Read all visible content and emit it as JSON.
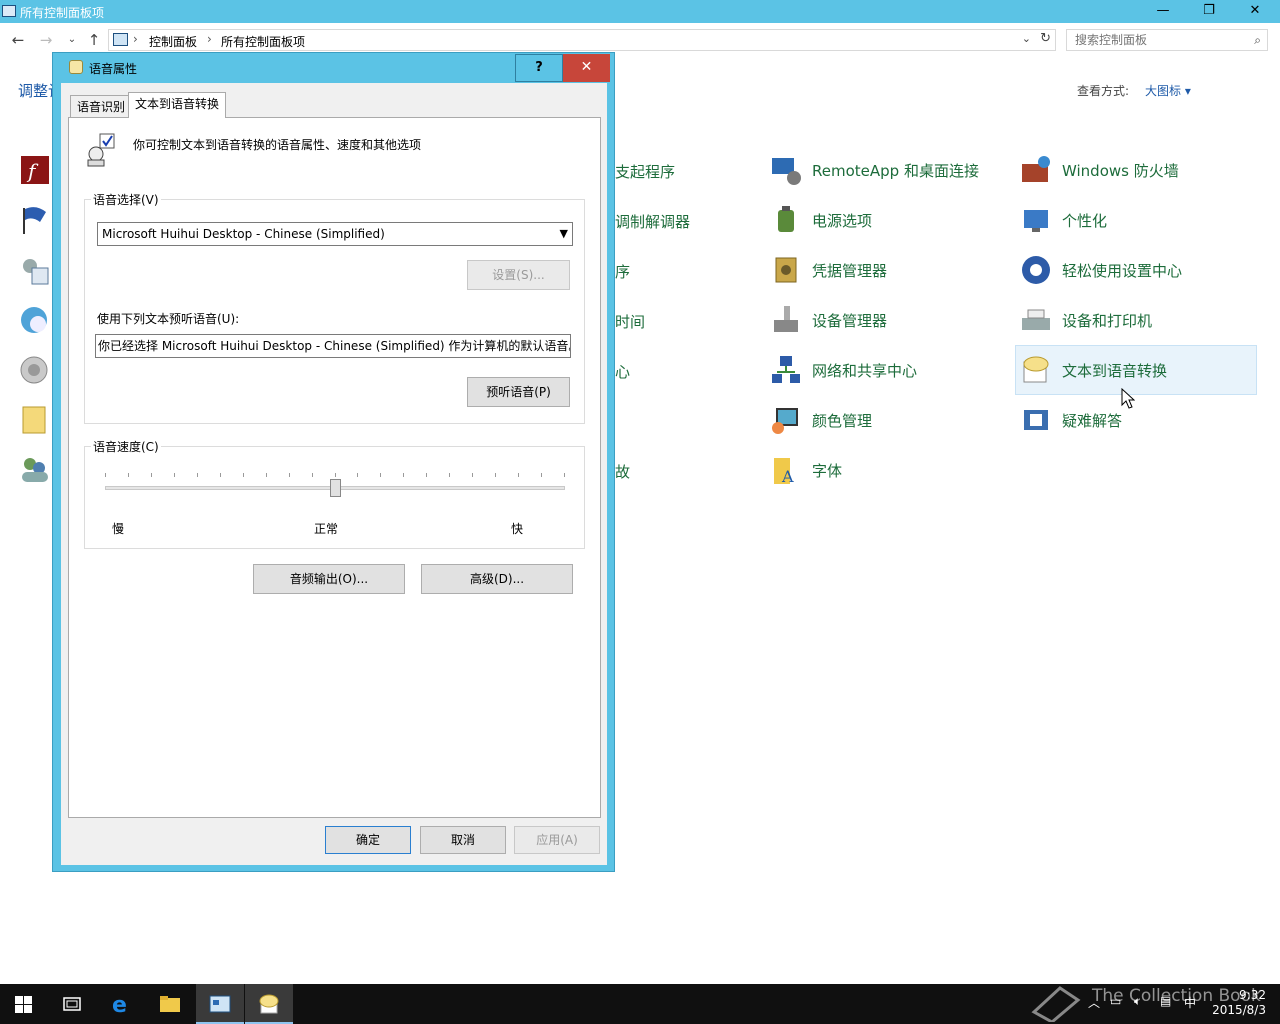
{
  "explorer": {
    "title": "所有控制面板项",
    "breadcrumb": [
      "控制面板",
      "所有控制面板项"
    ],
    "search_placeholder": "搜索控制面板",
    "left_heading": "调整计",
    "view_by_label": "查看方式:",
    "view_by_value": "大图标 ▾",
    "partial_items": [
      "支起程序",
      "调制解调器",
      "序",
      "时间",
      "心",
      "",
      "故"
    ],
    "items_col2": [
      "RemoteApp 和桌面连接",
      "电源选项",
      "凭据管理器",
      "设备管理器",
      "网络和共享中心",
      "颜色管理",
      "字体"
    ],
    "items_col3": [
      "Windows 防火墙",
      "个性化",
      "轻松使用设置中心",
      "设备和打印机",
      "文本到语音转换",
      "疑难解答"
    ]
  },
  "dialog": {
    "title": "语音属性",
    "help": "?",
    "close": "✕",
    "tabs": [
      "语音识别",
      "文本到语音转换"
    ],
    "description": "你可控制文本到语音转换的语音属性、速度和其他选项",
    "voice_group": "语音选择(V)",
    "voice_selected": "Microsoft Huihui Desktop - Chinese (Simplified)",
    "settings_button": "设置(S)...",
    "preview_label": "使用下列文本预听语音(U):",
    "preview_text": "你已经选择 Microsoft Huihui Desktop - Chinese (Simplified) 作为计算机的默认语音。",
    "preview_button": "预听语音(P)",
    "speed_group": "语音速度(C)",
    "speed_labels": [
      "慢",
      "正常",
      "快"
    ],
    "speed_level": 0.5,
    "audio_output_button": "音频输出(O)...",
    "advanced_button": "高级(D)...",
    "ok_button": "确定",
    "cancel_button": "取消",
    "apply_button": "应用(A)"
  },
  "taskbar": {
    "clock_time": "9:32",
    "clock_date": "2015/8/3",
    "ime": "中"
  },
  "watermark": "The Collection Book"
}
